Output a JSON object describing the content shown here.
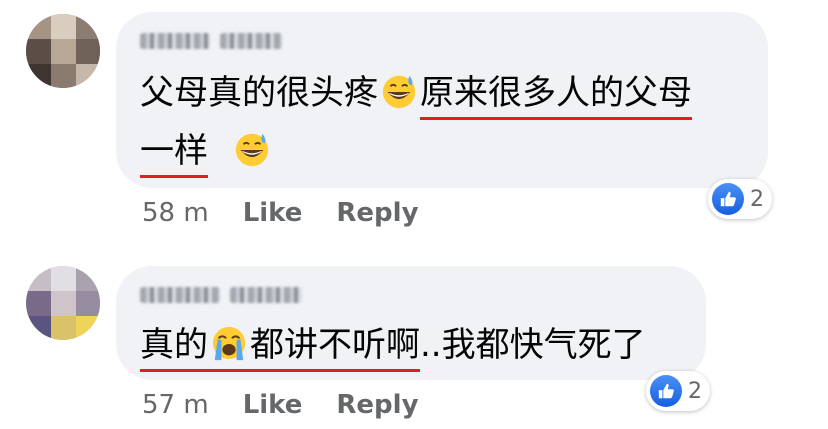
{
  "comments": [
    {
      "text_parts": [
        "父母真的很头疼",
        "原来很多人的父母",
        "一样"
      ],
      "time": "58 m",
      "like_label": "Like",
      "reply_label": "Reply",
      "reaction_count": "2"
    },
    {
      "text_parts": [
        "真的",
        "都讲不听啊",
        "..我都快气死了"
      ],
      "time": "57 m",
      "like_label": "Like",
      "reply_label": "Reply",
      "reaction_count": "2"
    }
  ],
  "icons": {
    "emoji_1": "grinning-sweat-emoji-icon",
    "emoji_2": "loudly-crying-emoji-icon",
    "reaction": "thumbs-up-icon"
  },
  "colors": {
    "bubble": "#f0f2f5",
    "underline": "#e02020",
    "like": "#1877f2",
    "meta": "#65676b"
  }
}
